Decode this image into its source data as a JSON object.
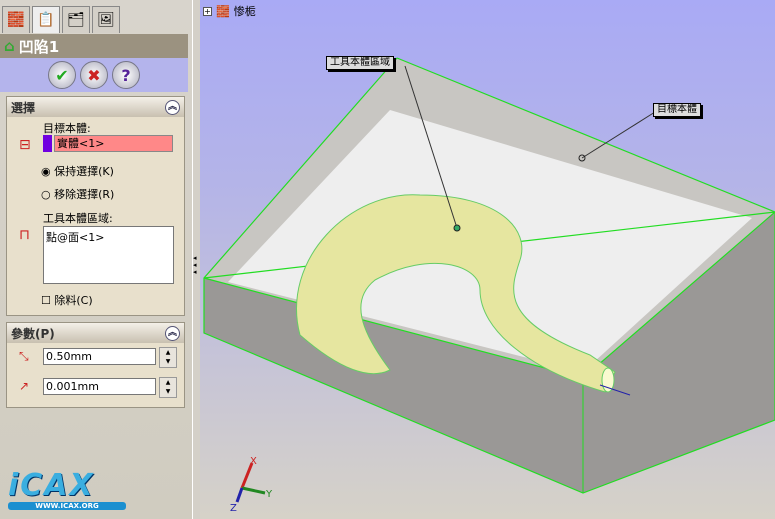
{
  "panel": {
    "tabs": [
      "feature-manager",
      "property-manager",
      "configuration-manager",
      "display-manager"
    ],
    "title": "凹陷1",
    "buttons": {
      "ok": "✔",
      "cancel": "✖",
      "help": "?"
    },
    "selection": {
      "heading": "選擇",
      "target_label": "目標本體:",
      "target_value": "實體<1>",
      "keep_label": "保持選擇(K)",
      "remove_label": "移除選擇(R)",
      "keep_selected": true,
      "tool_label": "工具本體區域:",
      "tool_value": "點@面<1>",
      "cut_label": "除料(C)",
      "cut_checked": false
    },
    "params": {
      "heading": "參數(P)",
      "thickness": "0.50mm",
      "clearance": "0.001mm"
    }
  },
  "viewport": {
    "tree_item": "惨栀",
    "callout_tool": "工具本體區域",
    "callout_target": "目標本體",
    "axes": {
      "x": "X",
      "y": "Y",
      "z": "Z"
    }
  },
  "logo": {
    "text": "ICAX",
    "url": "WWW.ICAX.ORG"
  }
}
